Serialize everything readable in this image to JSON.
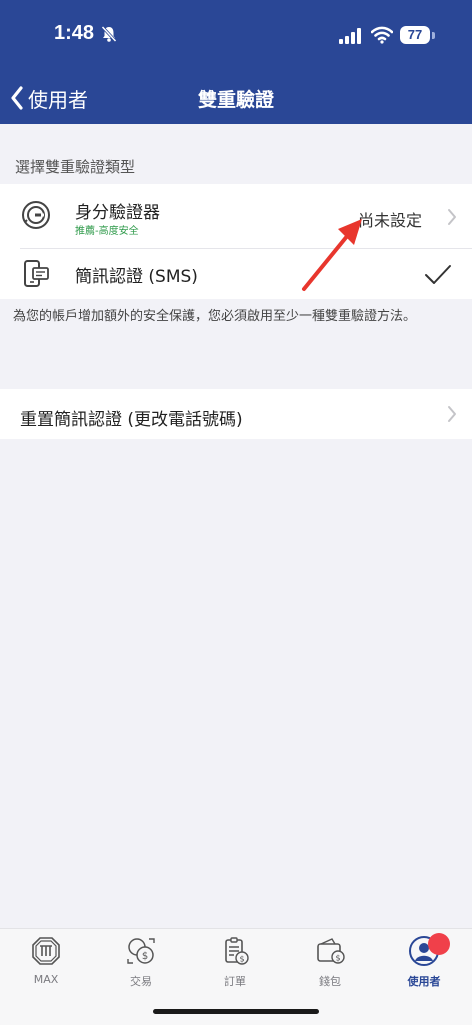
{
  "status_bar": {
    "time": "1:48",
    "battery": "77"
  },
  "nav": {
    "back_label": "使用者",
    "title": "雙重驗證"
  },
  "section": {
    "header": "選擇雙重驗證類型"
  },
  "methods": [
    {
      "title": "身分驗證器",
      "subtitle": "推薦-高度安全",
      "value": "尚未設定",
      "icon": "authenticator-icon"
    },
    {
      "title": "簡訊認證 (SMS)",
      "value": "",
      "icon": "sms-phone-icon",
      "selected": true
    }
  ],
  "footnote": "為您的帳戶增加額外的安全保護，您必須啟用至少一種雙重驗證方法。",
  "reset": {
    "label": "重置簡訊認證 (更改電話號碼)"
  },
  "tabs": [
    {
      "label": "MAX",
      "icon": "max-icon"
    },
    {
      "label": "交易",
      "icon": "exchange-icon"
    },
    {
      "label": "訂單",
      "icon": "orders-icon"
    },
    {
      "label": "錢包",
      "icon": "wallet-icon"
    },
    {
      "label": "使用者",
      "icon": "user-icon",
      "active": true
    }
  ],
  "colors": {
    "brand": "#2a4796",
    "recommend": "#2e9a4a",
    "annotation": "#e8362d",
    "badge": "#f0404a"
  }
}
